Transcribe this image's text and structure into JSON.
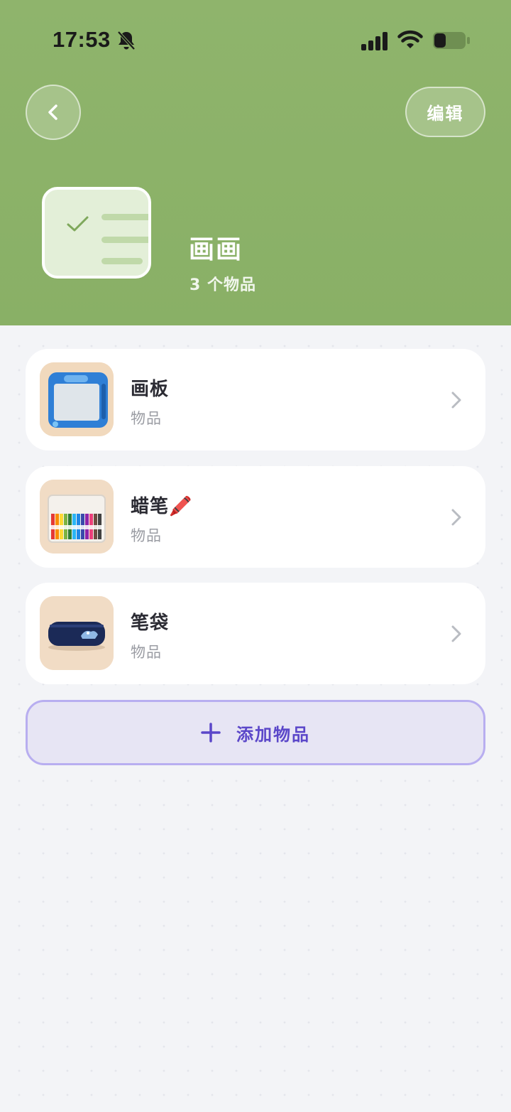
{
  "status_bar": {
    "time": "17:53",
    "icons": [
      "bell-slash-icon",
      "signal-icon",
      "wifi-icon",
      "battery-icon"
    ]
  },
  "header": {
    "back_icon": "chevron-left-icon",
    "edit_label": "编辑",
    "category_title": "画画",
    "item_count": "3 个物品",
    "cover_icon": "checklist-icon",
    "bg_color": "#8cb269"
  },
  "items": [
    {
      "name": "画板",
      "type": "物品",
      "image": "drawing-board"
    },
    {
      "name": "蜡笔🖍️",
      "type": "物品",
      "image": "crayons-box"
    },
    {
      "name": "笔袋",
      "type": "物品",
      "image": "pencil-case"
    }
  ],
  "add_button": {
    "label": "添加物品",
    "icon": "plus-icon",
    "color": "#5b47c9"
  }
}
